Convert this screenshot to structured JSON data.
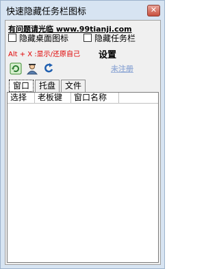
{
  "window": {
    "title": "快速隐藏任务栏图标",
    "close_glyph": "✕"
  },
  "contact": "有问题请光临 www.99tianji.com",
  "options": {
    "hide_desktop_icons": "隐藏桌面图标",
    "hide_taskbar": "隐藏任务栏"
  },
  "hotkey_hint": "Alt + X :显示/还原自己",
  "settings_label": "设置",
  "toolbar": {
    "icons": [
      "refresh-icon",
      "hide-icon",
      "restore-icon"
    ]
  },
  "unregistered_label": "未注册",
  "tabs": [
    "窗口",
    "托盘",
    "文件"
  ],
  "table": {
    "columns": [
      "选择",
      "老板键",
      "窗口名称"
    ]
  }
}
